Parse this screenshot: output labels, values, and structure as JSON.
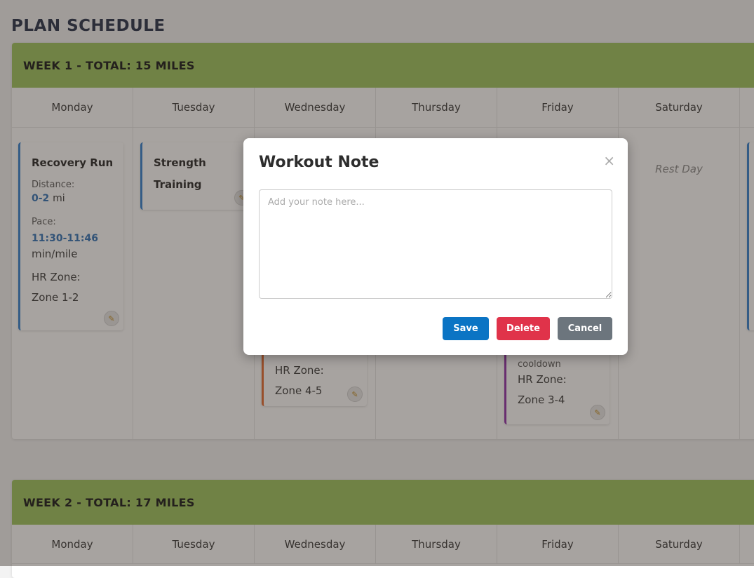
{
  "page_title": "PLAN SCHEDULE",
  "weeks": [
    {
      "header": "WEEK 1 - TOTAL: 15 MILES",
      "days": [
        "Monday",
        "Tuesday",
        "Wednesday",
        "Thursday",
        "Friday",
        "Saturday"
      ]
    },
    {
      "header": "WEEK 2 - TOTAL: 17 MILES",
      "days": [
        "Monday",
        "Tuesday",
        "Wednesday",
        "Thursday",
        "Friday",
        "Saturday"
      ]
    }
  ],
  "cards": {
    "monday": {
      "title": "Recovery Run",
      "distance_label": "Distance:",
      "distance_value": "0-2",
      "distance_unit": "mi",
      "pace_label": "Pace:",
      "pace_value": "11:30-11:46",
      "pace_unit": "min/mile",
      "hr_label": "HR Zone:",
      "hr_value": "Zone 1-2"
    },
    "tuesday": {
      "title_line1": "Strength",
      "title_line2": "Training"
    },
    "wednesday": {
      "hr_label": "HR Zone:",
      "hr_value": "Zone 4-5"
    },
    "friday": {
      "extra": "cooldown",
      "hr_label": "HR Zone:",
      "hr_value": "Zone 3-4"
    },
    "saturday": {
      "rest": "Rest Day"
    }
  },
  "modal": {
    "title": "Workout Note",
    "close_glyph": "×",
    "placeholder": "Add your note here...",
    "save_label": "Save",
    "delete_label": "Delete",
    "cancel_label": "Cancel"
  },
  "icons": {
    "note": "note-edit-icon",
    "close": "close-icon"
  },
  "colors": {
    "week_header": "#9bc35a",
    "save": "#0b74c4",
    "delete": "#e0334a",
    "cancel": "#6c757d",
    "accent_blue": "#2f7fd0"
  }
}
